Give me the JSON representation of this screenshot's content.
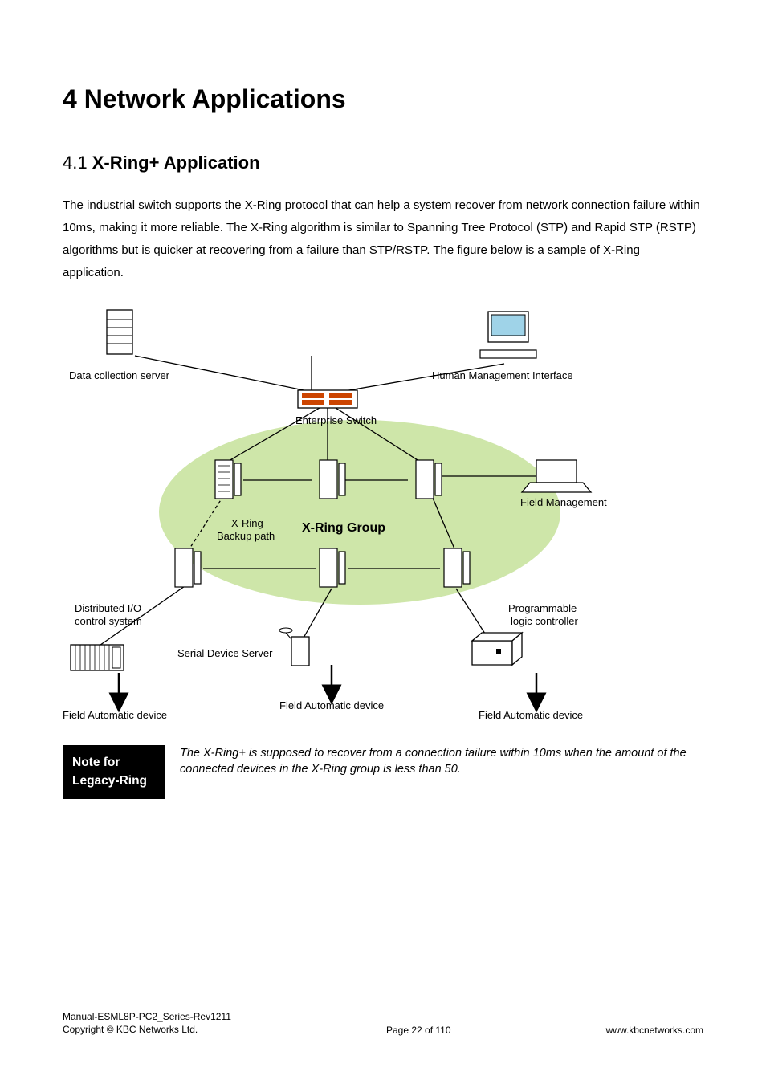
{
  "chapter": {
    "number": "4",
    "title": "Network Applications"
  },
  "section": {
    "number": "4.1",
    "title": "X-Ring+ Application"
  },
  "body_paragraph": "The industrial switch supports the X-Ring protocol that can help a system recover from network connection failure within 10ms, making it more reliable. The X-Ring algorithm is similar to Spanning Tree Protocol (STP) and Rapid STP (RSTP) algorithms but is quicker at recovering from a failure than STP/RSTP. The figure below is a sample of X-Ring application.",
  "diagram": {
    "labels": {
      "data_collection_server": "Data collection server",
      "hmi": "Human Management Interface",
      "enterprise_switch": "Enterprise Switch",
      "x_ring_backup_path_1": "X-Ring",
      "x_ring_backup_path_2": "Backup path",
      "x_ring_group": "X-Ring Group",
      "field_management": "Field Management",
      "distributed_io_1": "Distributed I/O",
      "distributed_io_2": "control system",
      "serial_device_server": "Serial Device Server",
      "programmable_1": "Programmable",
      "programmable_2": "logic controller",
      "field_auto_left": "Field Automatic device",
      "field_auto_center": "Field Automatic device",
      "field_auto_right": "Field Automatic device"
    }
  },
  "note": {
    "heading_1": "Note for",
    "heading_2": "Legacy-Ring",
    "text": "The X-Ring+ is supposed to recover from a connection failure within 10ms when the amount of the connected devices in the X-Ring group is less than 50."
  },
  "footer": {
    "manual": "Manual-ESML8P-PC2_Series-Rev1211",
    "copyright": "Copyright © KBC Networks Ltd.",
    "page": "Page 22 of 110",
    "url": "www.kbcnetworks.com"
  }
}
